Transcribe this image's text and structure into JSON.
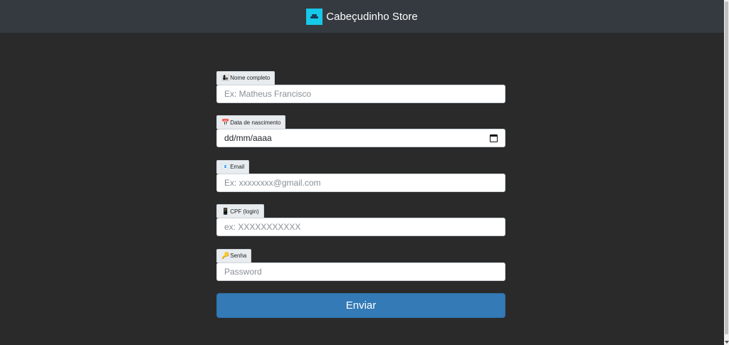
{
  "navbar": {
    "brand_name": "Cabeçudinho Store",
    "brand_icon": "sofa-icon",
    "background": "#343a40",
    "logo_color": "#16c8e8"
  },
  "form": {
    "fields": [
      {
        "label": "Nome completo",
        "icon": "👩‍👦",
        "placeholder": "Ex: Matheus Francisco"
      },
      {
        "label": "Data de nascimento",
        "icon": "📅",
        "value": "dd/mm/aaaa"
      },
      {
        "label": "Email",
        "icon": "📧",
        "placeholder": "Ex: xxxxxxxx@gmail.com"
      },
      {
        "label": "CPF (login)",
        "icon": "📱",
        "placeholder": "ex: XXXXXXXXXXX"
      },
      {
        "label": "Senha",
        "icon": "🔑",
        "placeholder": "Password"
      }
    ],
    "submit_label": "Enviar",
    "submit_color": "#337ab7"
  },
  "page": {
    "background": "#2a2a2a"
  }
}
